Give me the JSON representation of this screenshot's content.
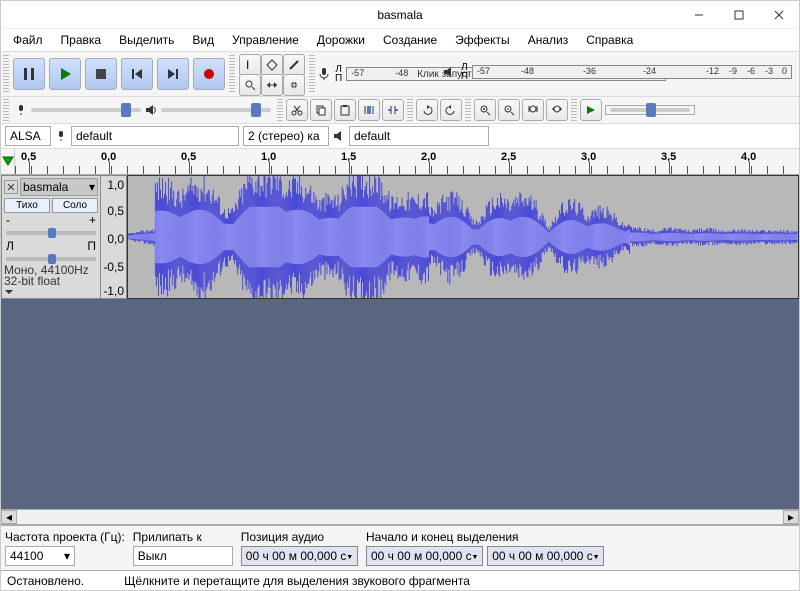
{
  "window": {
    "title": "basmala"
  },
  "menu": [
    "Файл",
    "Правка",
    "Выделить",
    "Вид",
    "Управление",
    "Дорожки",
    "Создание",
    "Эффекты",
    "Анализ",
    "Справка"
  ],
  "meters": {
    "rec_label": "Л\nП",
    "play_label": "Л\nП",
    "ticks": [
      "-57",
      "-48",
      "-36",
      "-24",
      "-12",
      "-9",
      "-6",
      "-3",
      "0"
    ],
    "rec_hint": "Клик запустит Мониторинг"
  },
  "devices": {
    "host": "ALSA",
    "rec_device": "default",
    "rec_channels": "2 (стерео) ка",
    "play_device": "default"
  },
  "timeline": {
    "labels": [
      "0,5",
      "0,0",
      "0,5",
      "1,0",
      "1,5",
      "2,0",
      "2,5",
      "3,0",
      "3,5",
      "4,0"
    ],
    "positions": [
      28,
      108,
      188,
      268,
      348,
      428,
      508,
      588,
      668,
      748
    ]
  },
  "track": {
    "name": "basmala",
    "mute": "Тихо",
    "solo": "Соло",
    "gain_left": "-",
    "gain_right": "+",
    "pan_left": "Л",
    "pan_right": "П",
    "info1": "Моно, 44100Hz",
    "info2": "32-bit float",
    "vscale": [
      "1,0",
      "0,5",
      "0,0",
      "-0,5",
      "-1,0"
    ]
  },
  "bottom": {
    "rate_label": "Частота проекта (Гц):",
    "rate_value": "44100",
    "snap_label": "Прилипать к",
    "snap_value": "Выкл",
    "pos_label": "Позиция аудио",
    "sel_label": "Начало и конец выделения",
    "time_zero": "00 ч 00 м 00,000 с"
  },
  "status": {
    "state": "Остановлено.",
    "hint": "Щёлкните и перетащите для выделения звукового фрагмента"
  }
}
